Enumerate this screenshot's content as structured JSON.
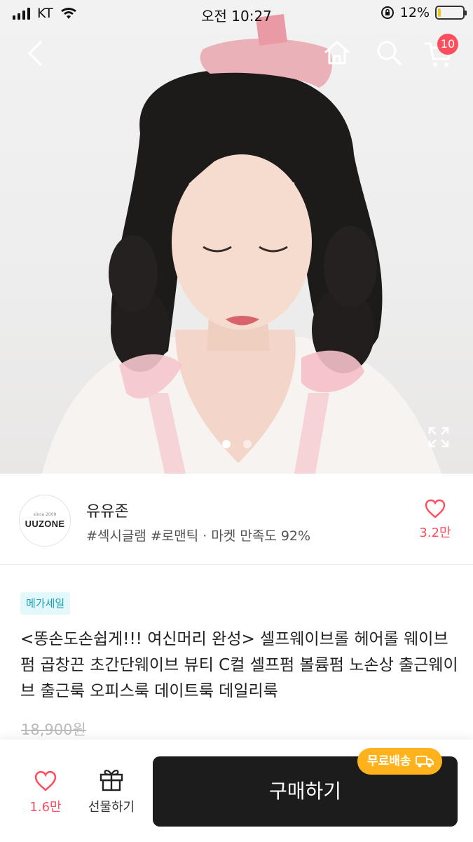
{
  "status_bar": {
    "carrier": "KT",
    "time": "오전 10:27",
    "battery_text": "12%",
    "battery_level": 0.12
  },
  "nav": {
    "cart_count": "10"
  },
  "gallery": {
    "page_count": 2,
    "active_index": 0
  },
  "seller": {
    "logo_since": "since 2009",
    "logo_text": "UUZONE",
    "name": "유유존",
    "tags": "#섹시글램 #로맨틱 · 마켓 만족도 92%",
    "like_count": "3.2만"
  },
  "product": {
    "badge": "메가세일",
    "title": "<똥손도손쉽게!!! 여신머리 완성> 셀프웨이브롤 헤어롤 웨이브펌 곱창끈 초간단웨이브 뷰티 C컬 셀프펌 볼륨펌 노손상 출근웨이브 출근룩 오피스룩 데이트룩 데일리룩",
    "original_price": "18,900원"
  },
  "bottom_bar": {
    "like_count": "1.6만",
    "gift_label": "선물하기",
    "buy_label": "구매하기",
    "shipping_badge": "무료배송"
  },
  "colors": {
    "accent_pink": "#ff4f5e",
    "badge_teal": "#1a9fb3",
    "shipping_orange": "#ffb21c",
    "buy_button": "#1c1c1c"
  }
}
